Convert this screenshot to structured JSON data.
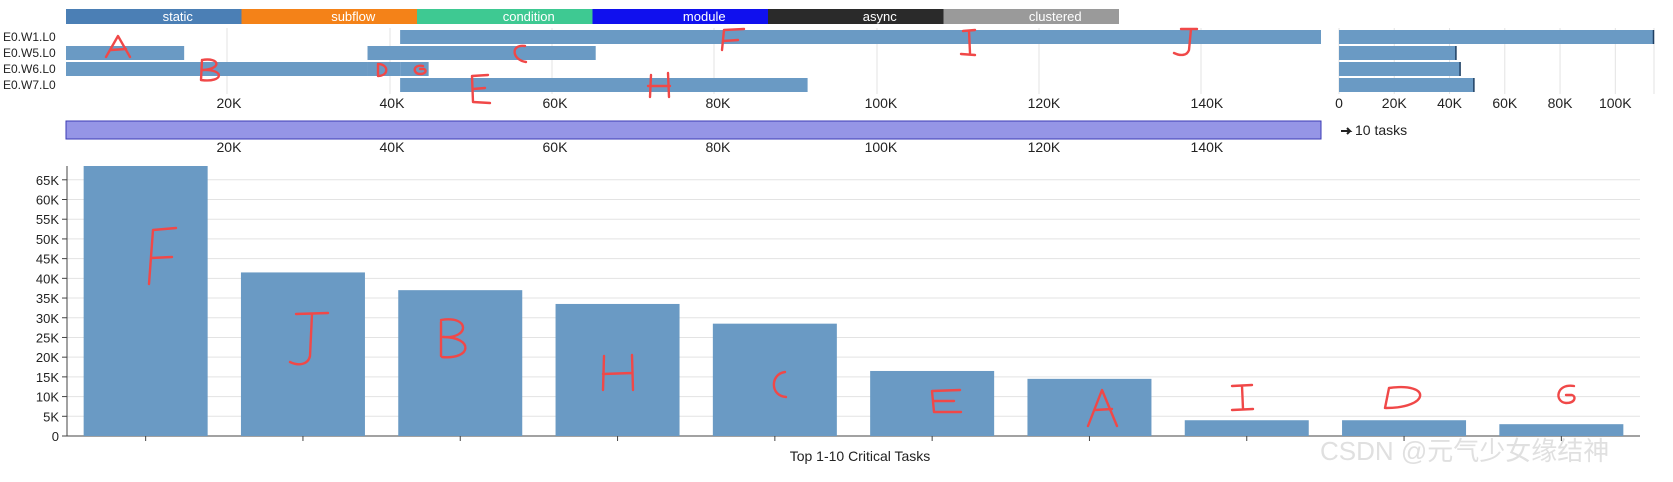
{
  "legend": [
    {
      "label": "static",
      "color": "#4b7fb5"
    },
    {
      "label": "subflow",
      "color": "#f48218"
    },
    {
      "label": "condition",
      "color": "#3ec992"
    },
    {
      "label": "module",
      "color": "#1010ee"
    },
    {
      "label": "async",
      "color": "#2a2a2a"
    },
    {
      "label": "clustered",
      "color": "#9a9a9a"
    }
  ],
  "colors": {
    "bar": "#6a9ac4",
    "brush": "#9595e6",
    "brush_border": "#3a3ab4"
  },
  "brush_label": "10 tasks",
  "watermark": "CSDN @元气少女缘结神",
  "chart_data": [
    {
      "type": "timeline",
      "lanes": [
        "E0.W1.L0",
        "E0.W5.L0",
        "E0.W6.L0",
        "E0.W7.L0"
      ],
      "segments": [
        {
          "lane": 0,
          "start": 41000,
          "end": 154000
        },
        {
          "lane": 1,
          "start": 0,
          "end": 14500
        },
        {
          "lane": 1,
          "start": 37000,
          "end": 65000
        },
        {
          "lane": 2,
          "start": 0,
          "end": 37000
        },
        {
          "lane": 2,
          "start": 37000,
          "end": 41000
        },
        {
          "lane": 2,
          "start": 41000,
          "end": 44500
        },
        {
          "lane": 3,
          "start": 41000,
          "end": 91000
        }
      ],
      "xlim": [
        0,
        154000
      ],
      "xticks": [
        "20K",
        "40K",
        "60K",
        "80K",
        "100K",
        "120K",
        "140K"
      ],
      "annotations": [
        "A",
        "B",
        "C",
        "D",
        "E",
        "F",
        "G",
        "H",
        "I",
        "J"
      ]
    },
    {
      "type": "bar",
      "orientation": "horizontal",
      "categories": [
        "E0.W1.L0",
        "E0.W5.L0",
        "E0.W6.L0",
        "E0.W7.L0"
      ],
      "values": [
        114000,
        42500,
        44000,
        49000
      ],
      "xlim": [
        0,
        114000
      ],
      "xticks": [
        "0",
        "20K",
        "40K",
        "60K",
        "80K",
        "100K"
      ]
    },
    {
      "type": "area",
      "role": "brush",
      "xlim": [
        0,
        154000
      ],
      "selection": [
        0,
        154000
      ],
      "xticks": [
        "20K",
        "40K",
        "60K",
        "80K",
        "100K",
        "120K",
        "140K"
      ]
    },
    {
      "type": "bar",
      "categories": [
        "F",
        "J",
        "B",
        "H",
        "C",
        "E",
        "A",
        "I",
        "D",
        "G"
      ],
      "values": [
        68500,
        41500,
        37000,
        33500,
        28500,
        16500,
        14500,
        4000,
        4000,
        3000
      ],
      "xlabel": "Top 1-10 Critical Tasks",
      "ylim": [
        0,
        68500
      ],
      "yticks": [
        "0",
        "5K",
        "10K",
        "15K",
        "20K",
        "25K",
        "30K",
        "35K",
        "40K",
        "45K",
        "50K",
        "55K",
        "60K",
        "65K"
      ]
    }
  ]
}
